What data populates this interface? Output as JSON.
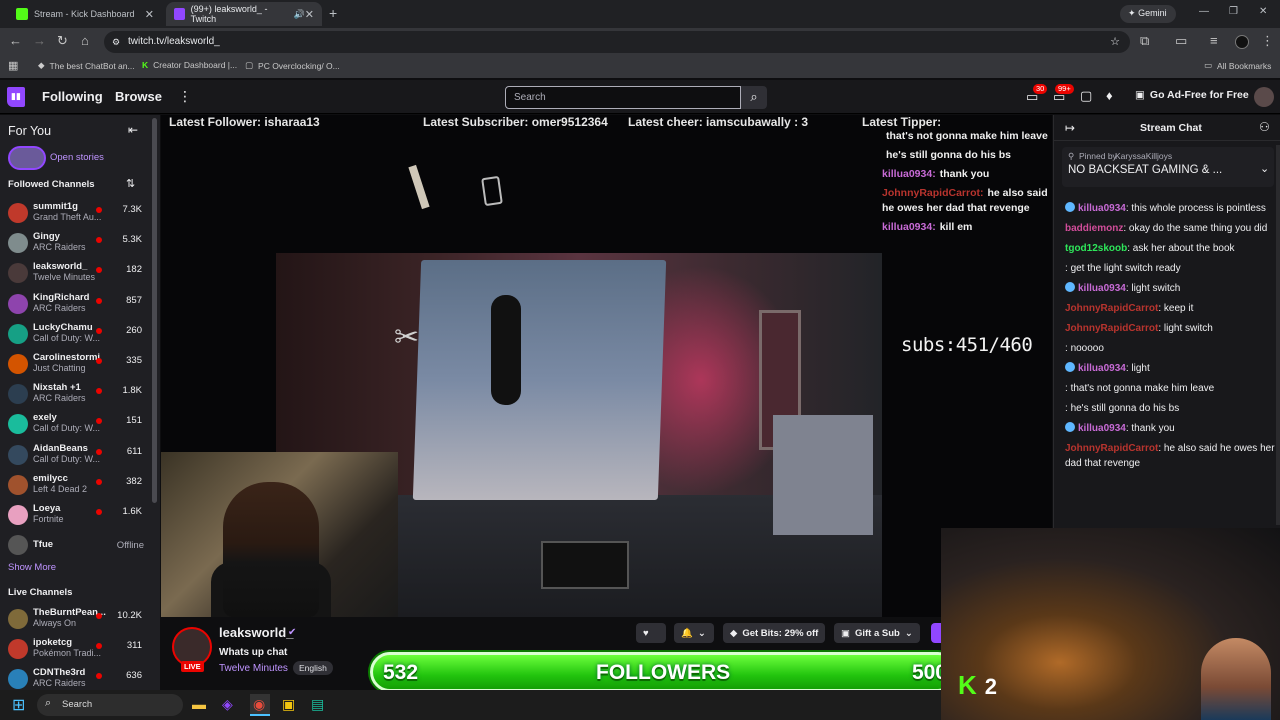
{
  "browser": {
    "tabs": [
      {
        "title": "Stream - Kick Dashboard",
        "active": false
      },
      {
        "title": "(99+) leaksworld_ - Twitch",
        "active": true
      }
    ],
    "gemini_label": "Gemini",
    "url": "twitch.tv/leaksworld_",
    "bookmarks": [
      "The best ChatBot an...",
      "Creator Dashboard |...",
      "PC Overclocking/ O..."
    ],
    "all_bookmarks": "All Bookmarks"
  },
  "twitch_nav": {
    "following": "Following",
    "browse": "Browse",
    "search_placeholder": "Search",
    "badge_inbox": "30",
    "badge_notif": "99+",
    "ad_free": "Go Ad-Free for Free"
  },
  "sidebar": {
    "for_you": "For You",
    "open_stories": "Open stories",
    "followed_header": "Followed Channels",
    "channels": [
      {
        "name": "summit1g",
        "game": "Grand Theft Au...",
        "viewers": "7.3K",
        "color": "#c0392b"
      },
      {
        "name": "Gingy",
        "game": "ARC Raiders",
        "viewers": "5.3K",
        "color": "#7f8c8d"
      },
      {
        "name": "leaksworld_",
        "game": "Twelve Minutes",
        "viewers": "182",
        "color": "#4a3a3a"
      },
      {
        "name": "KingRichard",
        "game": "ARC Raiders",
        "viewers": "857",
        "color": "#8e44ad"
      },
      {
        "name": "LuckyChamu",
        "game": "Call of Duty: W...",
        "viewers": "260",
        "color": "#16a085"
      },
      {
        "name": "Carolinestormi",
        "game": "Just Chatting",
        "viewers": "335",
        "color": "#d35400"
      },
      {
        "name": "Nixstah +1",
        "game": "ARC Raiders",
        "viewers": "1.8K",
        "color": "#2c3e50"
      },
      {
        "name": "exely",
        "game": "Call of Duty: W...",
        "viewers": "151",
        "color": "#1abc9c"
      },
      {
        "name": "AidanBeans",
        "game": "Call of Duty: W...",
        "viewers": "611",
        "color": "#34495e"
      },
      {
        "name": "emilycc",
        "game": "Left 4 Dead 2",
        "viewers": "382",
        "color": "#a0522d"
      },
      {
        "name": "Loeya",
        "game": "Fortnite",
        "viewers": "1.6K",
        "color": "#e8a0c0"
      },
      {
        "name": "Tfue",
        "game": "",
        "viewers": "Offline",
        "color": "#555555"
      }
    ],
    "show_more": "Show More",
    "live_header": "Live Channels",
    "live_channels": [
      {
        "name": "TheBurntPean...",
        "game": "Always On",
        "viewers": "10.2K",
        "color": "#7f6a3a"
      },
      {
        "name": "ipoketcg",
        "game": "Pokémon Tradi...",
        "viewers": "311",
        "color": "#c0392b"
      },
      {
        "name": "CDNThe3rd",
        "game": "ARC Raiders",
        "viewers": "636",
        "color": "#2980b9"
      }
    ]
  },
  "video": {
    "latest_follower": "Latest Follower: isharaa13",
    "latest_subscriber": "Latest Subscriber: omer9512364",
    "latest_cheer": "Latest cheer: iamscubawally : 3",
    "latest_tipper": "Latest Tipper:",
    "subs": "subs:451/460",
    "overlay_chat": [
      {
        "user": "",
        "text": "that's not gonna make him leave",
        "color": "#3b3bd6"
      },
      {
        "user": "",
        "text": "he's still gonna do his bs",
        "color": "#3b3bd6"
      },
      {
        "user": "killua0934:",
        "text": "thank you",
        "color": "#c86bd6"
      },
      {
        "user": "JohnnyRapidCarrot:",
        "text": "he also said he owes her dad that revenge",
        "color": "#b8342e"
      },
      {
        "user": "killua0934:",
        "text": "kill em",
        "color": "#c86bd6"
      }
    ]
  },
  "channel_info": {
    "name": "leaksworld_",
    "title": "Whats up chat",
    "game": "Twelve Minutes",
    "language": "English",
    "live": "LIVE",
    "get_bits": "Get Bits: 29% off",
    "gift_sub": "Gift a Sub"
  },
  "followers_bar": {
    "current": "532",
    "label": "FOLLOWERS",
    "goal": "500"
  },
  "chat": {
    "title": "Stream Chat",
    "pinned_by": "Pinned by",
    "pinned_user": "KaryssaKilljoys",
    "pinned_text": "NO BACKSEAT GAMING & ...",
    "messages": [
      {
        "user": "killua0934",
        "text": "this whole process is pointless",
        "color": "#c86bd6",
        "badge": true
      },
      {
        "user": "baddiemonz",
        "text": "okay do the same thing you did",
        "color": "#d14d9a",
        "badge": false
      },
      {
        "user": "tgod12skoob",
        "text": "ask her about the book",
        "color": "#2ee65a",
        "badge": false
      },
      {
        "user": "",
        "text": "get the light switch ready",
        "color": "#3b3bd6",
        "badge": false
      },
      {
        "user": "killua0934",
        "text": "light switch",
        "color": "#c86bd6",
        "badge": true
      },
      {
        "user": "JohnnyRapidCarrot",
        "text": "keep it",
        "color": "#b8342e",
        "badge": false
      },
      {
        "user": "JohnnyRapidCarrot",
        "text": "light switch",
        "color": "#b8342e",
        "badge": false
      },
      {
        "user": "",
        "text": "nooooo",
        "color": "#3b3bd6",
        "badge": false
      },
      {
        "user": "killua0934",
        "text": "light",
        "color": "#c86bd6",
        "badge": true
      },
      {
        "user": "",
        "text": "that's not gonna make him leave",
        "color": "#3b3bd6",
        "badge": false
      },
      {
        "user": "",
        "text": "he's still gonna do his bs",
        "color": "#3b3bd6",
        "badge": false
      },
      {
        "user": "killua0934",
        "text": "thank you",
        "color": "#c86bd6",
        "badge": true
      },
      {
        "user": "JohnnyRapidCarrot",
        "text": "he also said he owes her dad that revenge",
        "color": "#b8342e",
        "badge": false
      }
    ]
  },
  "kick_overlay": {
    "count": "2"
  },
  "taskbar": {
    "search": "Search"
  },
  "colors": {
    "twitch_purple": "#9147ff",
    "kick_green": "#53fc18",
    "live_red": "#eb0400"
  }
}
